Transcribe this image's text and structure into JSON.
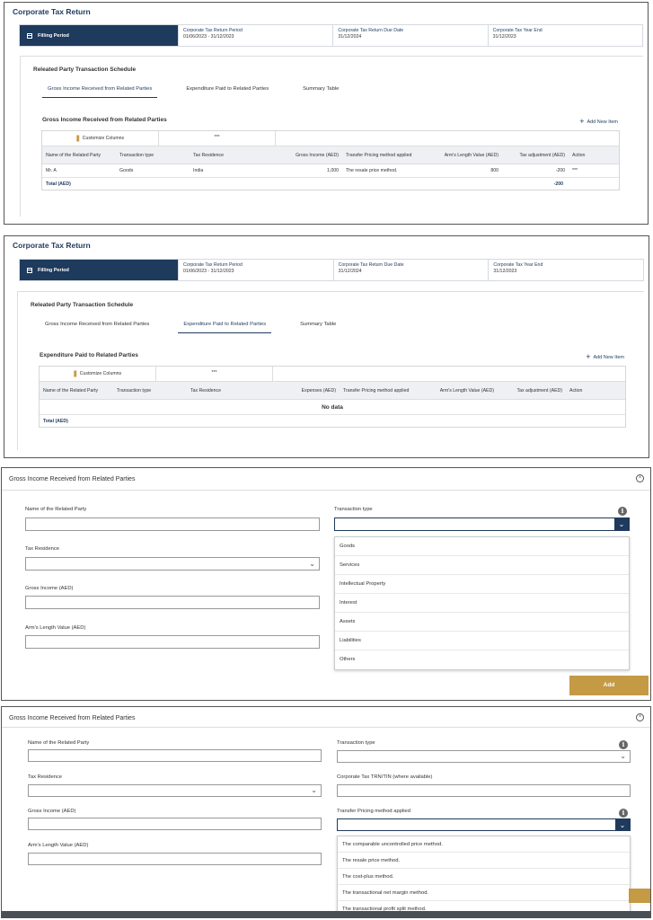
{
  "app_title": "Corporate Tax Return",
  "filing_period": {
    "label": "Filling Period",
    "period_label": "Corporate Tax Return Period",
    "period_value": "01/06/2023  -  31/12/2023",
    "due_label": "Corporate Tax Return Due Date",
    "due_value": "31/12/2024",
    "year_end_label": "Corporate Tax Year End",
    "year_end_value": "31/12/2023"
  },
  "schedule": {
    "title": "Releated Party Transaction Schedule",
    "tabs": [
      "Gross Income Received from Related Parties",
      "Expenditure Paid to Related Parties",
      "Summary Table"
    ],
    "add_new_item": "Add New Item",
    "customize_columns": "Customize Columns",
    "more": "***"
  },
  "income_table": {
    "title": "Gross Income Received from Related Parties",
    "headers": [
      "Name of the Related Party",
      "Transaction type",
      "Tax Residence",
      "Gross Income (AED)",
      "Transfer Pricing method applied",
      "Arm's Length Value (AED)",
      "Tax adjustment (AED)",
      "Action"
    ],
    "rows": [
      [
        "Mr. A",
        "Goods",
        "India",
        "1,000",
        "The resale price method.",
        "800",
        "-200",
        "***"
      ]
    ],
    "total_label": "Total (AED)",
    "total_value": "-200"
  },
  "expenditure_table": {
    "title": "Expenditure Paid to Related Parties",
    "headers": [
      "Name of the Related Party",
      "Transaction type",
      "Tax Residence",
      "Expenses (AED)",
      "Transfer Pricing method applied",
      "Arm's Length Value (AED)",
      "Tax adjustment (AED)",
      "Action"
    ],
    "no_data": "No data",
    "total_label": "Total (AED)"
  },
  "modal": {
    "title": "Gross Income Received from Related Parties",
    "close": "×",
    "name_label": "Name of the Related Party",
    "transaction_type_label": "Transaction type",
    "tax_residence_label": "Tax Residence",
    "gross_income_label": "Gross Income (AED)",
    "arms_length_label": "Arm's Length Value (AED)",
    "trn_label": "Corporate Tax TRN/TIN (where available)",
    "tp_method_label": "Transfer Pricing method applied",
    "info": "i",
    "transaction_options": [
      "Goods",
      "Services",
      "Intellectual Property",
      "Interest",
      "Assets",
      "Liabilities",
      "Others"
    ],
    "tp_method_options": [
      "The comparable uncontrolled price method.",
      "The resale price method.",
      "The cost-plus method.",
      "The transactional net margin method.",
      "The transactional profit split method."
    ],
    "add_button": "Add"
  },
  "icons": {
    "calendar": "calendar-icon",
    "plus": "plus-icon",
    "columns": "columns-icon",
    "chevron": "chevron-down-icon",
    "info": "info-icon",
    "close": "close-icon"
  },
  "colors": {
    "navy": "#1e3a5c",
    "gold": "#c49a45",
    "header_bg": "#eef0f3"
  }
}
